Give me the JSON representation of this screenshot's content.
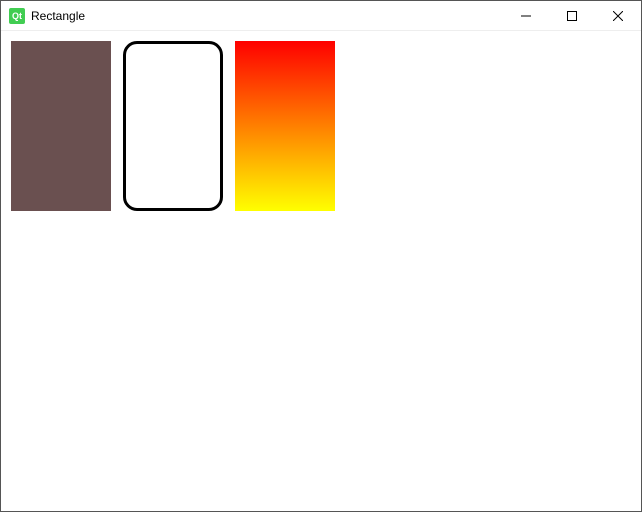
{
  "window": {
    "title": "Rectangle",
    "icon_label": "Qt",
    "controls": {
      "minimize": "—",
      "maximize": "☐",
      "close": "✕"
    }
  },
  "rects": [
    {
      "name": "rect-solid",
      "color": "#6a5050",
      "border_radius": 0,
      "border": "none"
    },
    {
      "name": "rect-outlined",
      "color": "#ffffff",
      "border_radius": 14,
      "border": "3px solid #000"
    },
    {
      "name": "rect-gradient",
      "gradient_top": "#ff0000",
      "gradient_bottom": "#ffff00",
      "border_radius": 0,
      "border": "none"
    }
  ]
}
